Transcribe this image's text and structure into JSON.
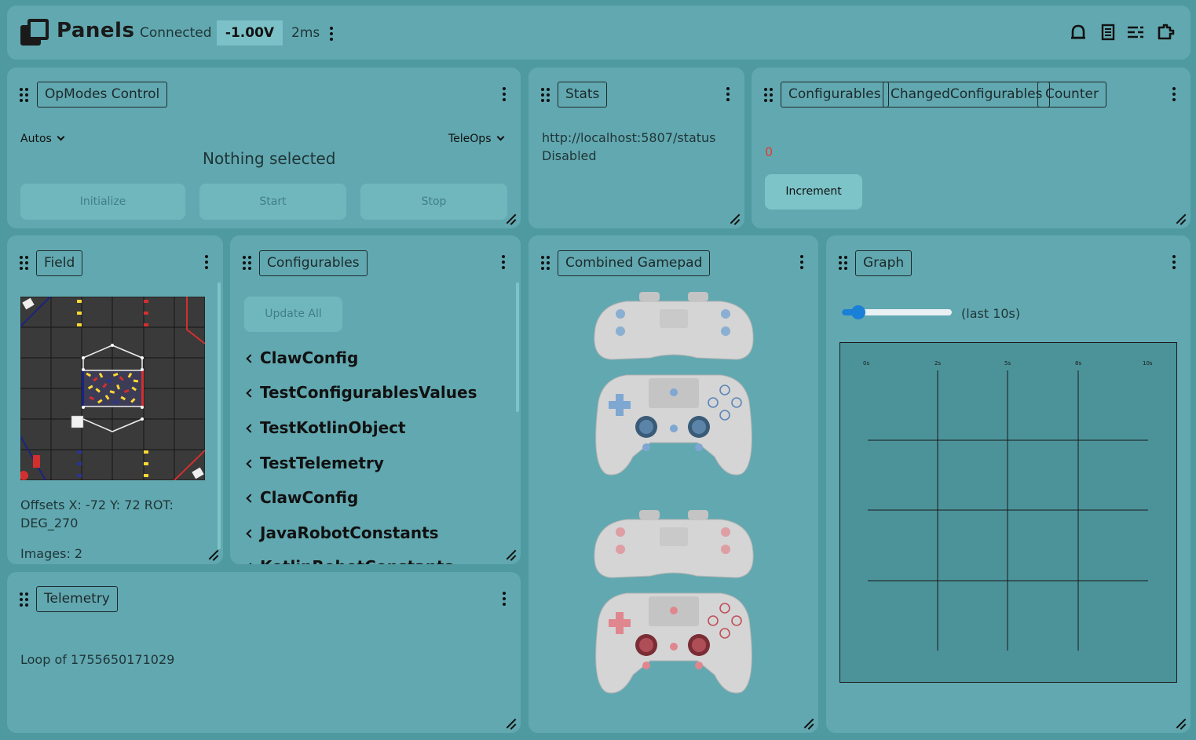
{
  "header": {
    "brand": "Panels",
    "status": "Connected",
    "voltage": "-1.00V",
    "latency": "2ms",
    "icons": [
      "bell-icon",
      "document-icon",
      "list-icon",
      "plugin-icon"
    ]
  },
  "opmodes": {
    "tab": "OpModes Control",
    "autos_label": "Autos",
    "teleops_label": "TeleOps",
    "selection": "Nothing selected",
    "init_label": "Initialize",
    "start_label": "Start",
    "stop_label": "Stop"
  },
  "stats": {
    "tab": "Stats",
    "url": "http://localhost:5807/status",
    "state": "Disabled"
  },
  "counter_panel": {
    "tabs": [
      "Configurables",
      "ChangedConfigurables",
      "Counter"
    ],
    "value": "0",
    "increment_label": "Increment"
  },
  "field": {
    "tab": "Field",
    "offsets": "Offsets X: -72 Y: 72 ROT: DEG_270",
    "images": "Images: 2"
  },
  "configurables": {
    "tab": "Configurables",
    "update_all": "Update All",
    "items": [
      "ClawConfig",
      "TestConfigurablesValues",
      "TestKotlinObject",
      "TestTelemetry",
      "ClawConfig",
      "JavaRobotConstants",
      "KotlinRobotConstants"
    ]
  },
  "gamepad": {
    "tab": "Combined Gamepad"
  },
  "graph": {
    "tab": "Graph",
    "window_label": "(last 10s)",
    "slider_value": 0.1,
    "ticks": [
      "0s",
      "2s",
      "5s",
      "8s",
      "10s"
    ]
  },
  "telemetry": {
    "tab": "Telemetry",
    "line": "Loop of 1755650171029"
  },
  "colors": {
    "background": "#4e9aa0",
    "card": "#62a8b0",
    "accent": "#1a7fd6",
    "counter_value": "#e53935"
  }
}
